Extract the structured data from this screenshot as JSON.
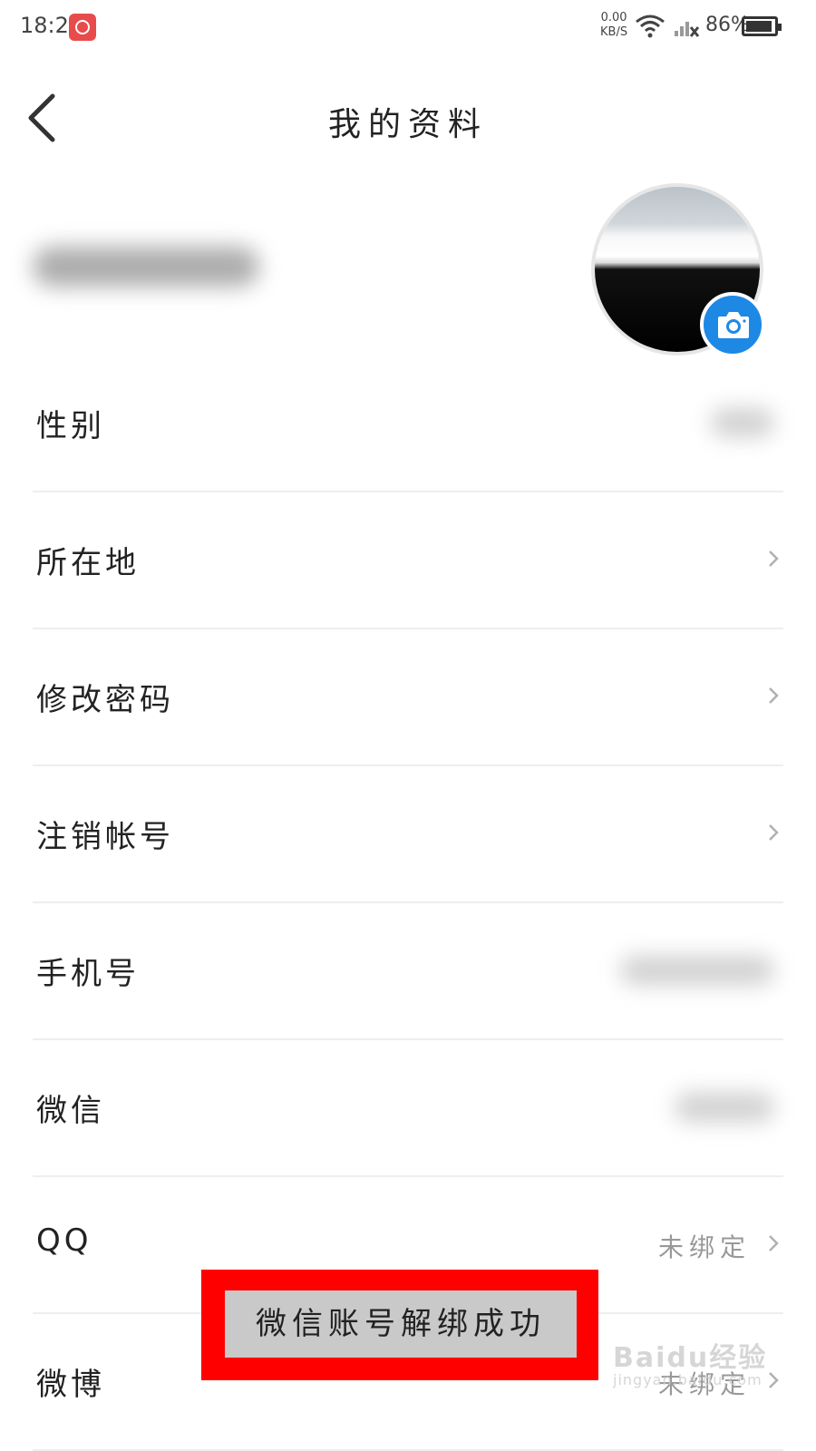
{
  "status_bar": {
    "time": "18:23",
    "net_speed_value": "0.00",
    "net_speed_unit": "KB/S",
    "battery_percent": "86%",
    "app_badge_color": "#e84b4b"
  },
  "header": {
    "title": "我的资料",
    "back_icon": "back-chevron-icon"
  },
  "profile": {
    "username_redacted": true,
    "avatar_icon": "avatar-photo",
    "camera_icon": "camera-icon",
    "camera_button_color": "#1e88e5"
  },
  "settings": {
    "rows": [
      {
        "label": "性别",
        "value": "",
        "value_redacted": true,
        "chevron": false
      },
      {
        "label": "所在地",
        "value": "",
        "value_redacted": false,
        "chevron": true
      },
      {
        "label": "修改密码",
        "value": "",
        "value_redacted": false,
        "chevron": true
      },
      {
        "label": "注销帐号",
        "value": "",
        "value_redacted": false,
        "chevron": true
      },
      {
        "label": "手机号",
        "value": "",
        "value_redacted": true,
        "chevron": false
      },
      {
        "label": "微信",
        "value": "",
        "value_redacted": true,
        "chevron": false
      },
      {
        "label": "QQ",
        "value": "未绑定",
        "value_redacted": false,
        "chevron": true
      },
      {
        "label": "微博",
        "value": "未绑定",
        "value_redacted": false,
        "chevron": true
      }
    ]
  },
  "toast": {
    "message": "微信账号解绑成功",
    "highlight_color": "#ff0000"
  },
  "watermark": {
    "main": "Baidu经验",
    "sub": "jingyan.baidu.com"
  }
}
